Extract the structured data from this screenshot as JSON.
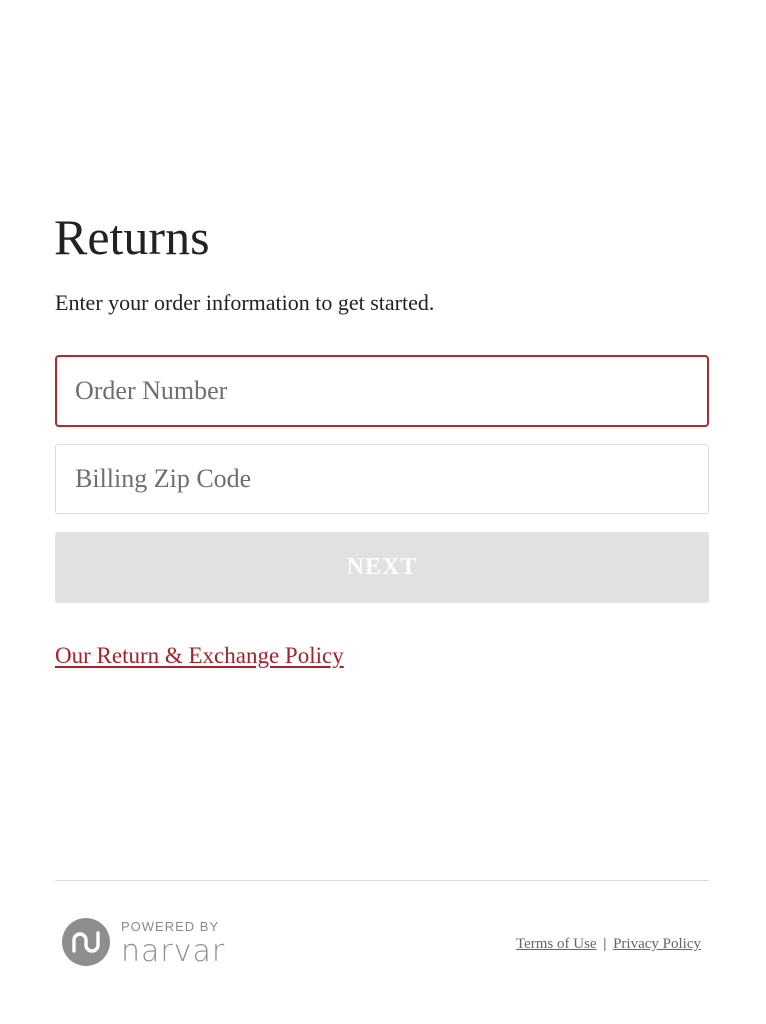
{
  "page": {
    "title": "Returns",
    "subtitle": "Enter your order information to get started."
  },
  "form": {
    "order_number": {
      "placeholder": "Order Number",
      "value": ""
    },
    "billing_zip": {
      "placeholder": "Billing Zip Code",
      "value": ""
    },
    "next_label": "NEXT",
    "policy_link_label": "Our Return & Exchange Policy"
  },
  "footer": {
    "powered_by": "POWERED BY",
    "brand": "narvar",
    "logo_icon": "narvar-logo-icon",
    "terms_label": "Terms of Use",
    "separator": "|",
    "privacy_label": "Privacy Policy"
  },
  "colors": {
    "accent": "#b5262e",
    "link": "#a5222b",
    "button_disabled": "#e1e1e1",
    "logo_gray": "#8e8e8e"
  }
}
